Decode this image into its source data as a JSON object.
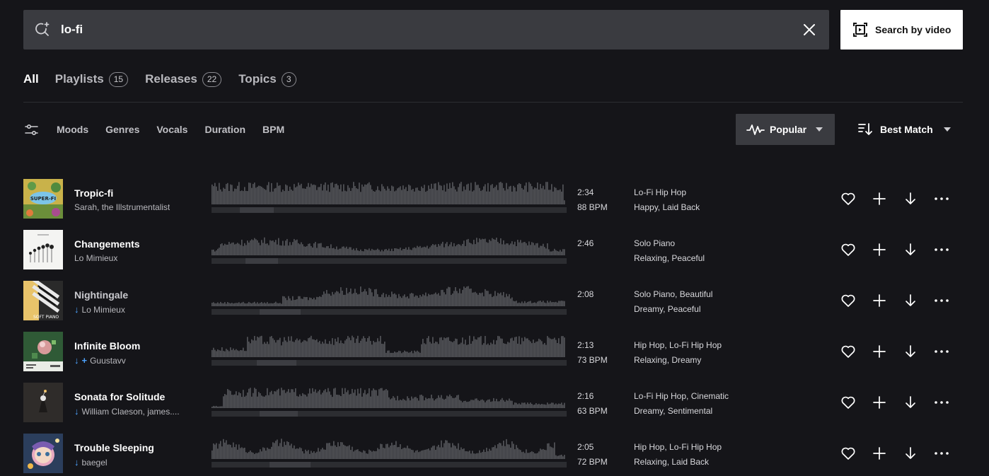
{
  "search": {
    "value": "lo-fi",
    "video_button_label": "Search by video"
  },
  "tabs": [
    {
      "label": "All",
      "count": ""
    },
    {
      "label": "Playlists",
      "count": "15"
    },
    {
      "label": "Releases",
      "count": "22"
    },
    {
      "label": "Topics",
      "count": "3"
    }
  ],
  "filters": [
    "Moods",
    "Genres",
    "Vocals",
    "Duration",
    "BPM"
  ],
  "sort": {
    "popular_label": "Popular",
    "order_label": "Best Match"
  },
  "colors": {
    "accent_blue": "#4ea3ff",
    "background": "#151519",
    "waveform": "#55565b",
    "waveform_track": "#2c2d31"
  },
  "tracks": [
    {
      "title": "Tropic-fi",
      "artist": "Sarah, the Illstrumentalist",
      "icons": [],
      "duration": "2:34",
      "bpm": "88 BPM",
      "genres": "Lo-Fi Hip Hop",
      "moods": "Happy, Laid Back"
    },
    {
      "title": "Changements",
      "artist": "Lo Mimieux",
      "icons": [],
      "duration": "2:46",
      "bpm": "",
      "genres": "Solo Piano",
      "moods": "Relaxing, Peaceful"
    },
    {
      "title": "Nightingale",
      "artist": "Lo Mimieux",
      "icons": [
        "arrow-down-icon"
      ],
      "duration": "2:08",
      "bpm": "",
      "genres": "Solo Piano, Beautiful",
      "moods": "Dreamy, Peaceful"
    },
    {
      "title": "Infinite Bloom",
      "artist": "Guustavv",
      "icons": [
        "arrow-down-icon",
        "plus-icon"
      ],
      "duration": "2:13",
      "bpm": "73 BPM",
      "genres": "Hip Hop, Lo-Fi Hip Hop",
      "moods": "Relaxing, Dreamy"
    },
    {
      "title": "Sonata for Solitude",
      "artist": "William Claeson, james....",
      "icons": [
        "arrow-down-icon"
      ],
      "duration": "2:16",
      "bpm": "63 BPM",
      "genres": "Lo-Fi Hip Hop, Cinematic",
      "moods": "Dreamy, Sentimental"
    },
    {
      "title": "Trouble Sleeping",
      "artist": "baegel",
      "icons": [
        "arrow-down-icon"
      ],
      "duration": "2:05",
      "bpm": "72 BPM",
      "genres": "Hip Hop, Lo-Fi Hip Hop",
      "moods": "Relaxing, Laid Back"
    }
  ]
}
